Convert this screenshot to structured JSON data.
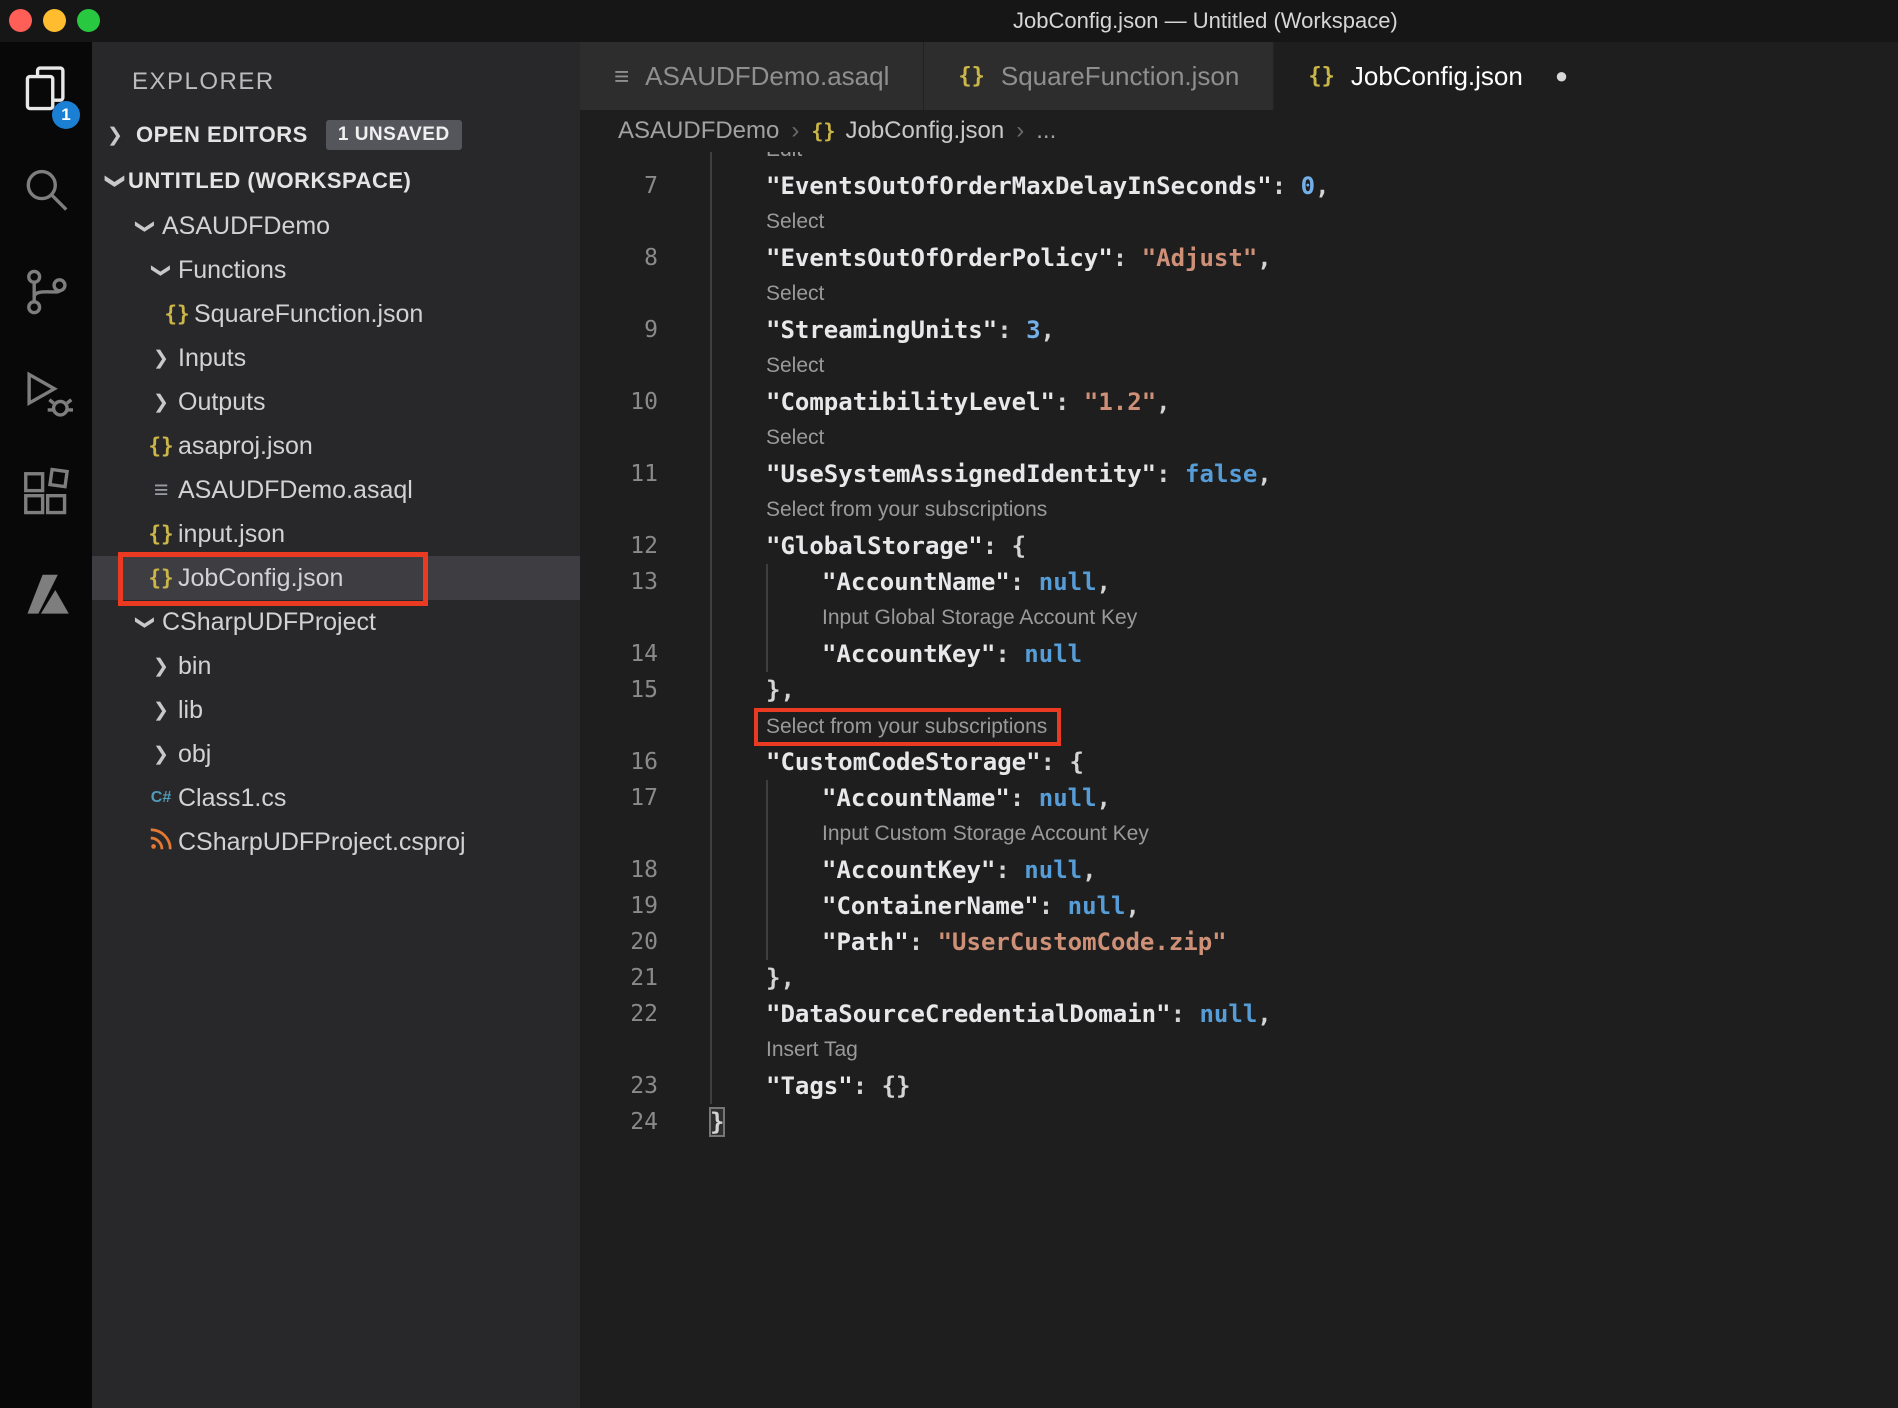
{
  "window": {
    "title": "JobConfig.json — Untitled (Workspace)"
  },
  "colors": {
    "annotation_red": "#ea3a21",
    "badge_blue": "#1b80d4",
    "json_icon_yellow": "#cbb648",
    "string_orange": "#ce9178",
    "keyword_blue": "#569cd6"
  },
  "activity_bar": {
    "badge": "1",
    "items": [
      {
        "name": "explorer",
        "active": true
      },
      {
        "name": "search",
        "active": false
      },
      {
        "name": "source-control",
        "active": false
      },
      {
        "name": "run-debug",
        "active": false
      },
      {
        "name": "extensions",
        "active": false
      },
      {
        "name": "azure",
        "active": false
      }
    ]
  },
  "explorer": {
    "title": "EXPLORER",
    "open_editors": {
      "label": "OPEN EDITORS",
      "badge": "1 UNSAVED"
    },
    "workspace_label": "UNTITLED (WORKSPACE)",
    "tree": [
      {
        "label": "ASAUDFDemo",
        "type": "folder",
        "state": "expanded",
        "depth": 1
      },
      {
        "label": "Functions",
        "type": "folder",
        "state": "expanded",
        "depth": 2
      },
      {
        "label": "SquareFunction.json",
        "type": "json",
        "depth": 3
      },
      {
        "label": "Inputs",
        "type": "folder",
        "state": "collapsed",
        "depth": 2
      },
      {
        "label": "Outputs",
        "type": "folder",
        "state": "collapsed",
        "depth": 2
      },
      {
        "label": "asaproj.json",
        "type": "json",
        "depth": 2
      },
      {
        "label": "ASAUDFDemo.asaql",
        "type": "asaql",
        "depth": 2
      },
      {
        "label": "input.json",
        "type": "json",
        "depth": 2
      },
      {
        "label": "JobConfig.json",
        "type": "json",
        "depth": 2,
        "selected": true,
        "red_box": true
      },
      {
        "label": "CSharpUDFProject",
        "type": "folder",
        "state": "expanded",
        "depth": 1
      },
      {
        "label": "bin",
        "type": "folder",
        "state": "collapsed",
        "depth": 2
      },
      {
        "label": "lib",
        "type": "folder",
        "state": "collapsed",
        "depth": 2
      },
      {
        "label": "obj",
        "type": "folder",
        "state": "collapsed",
        "depth": 2
      },
      {
        "label": "Class1.cs",
        "type": "cs",
        "depth": 2
      },
      {
        "label": "CSharpUDFProject.csproj",
        "type": "csproj",
        "depth": 2
      }
    ]
  },
  "tabs": [
    {
      "label": "ASAUDFDemo.asaql",
      "icon": "asaql",
      "active": false,
      "dirty": false
    },
    {
      "label": "SquareFunction.json",
      "icon": "json",
      "active": false,
      "dirty": false
    },
    {
      "label": "JobConfig.json",
      "icon": "json",
      "active": true,
      "dirty": true
    }
  ],
  "breadcrumb": {
    "items": [
      {
        "label": "ASAUDFDemo",
        "icon": null
      },
      {
        "label": "JobConfig.json",
        "icon": "json"
      },
      {
        "label": "...",
        "icon": null
      }
    ]
  },
  "editor": {
    "rows": [
      {
        "kind": "lens",
        "text": "Edit",
        "indent": 1,
        "guides": 1,
        "clipped": true
      },
      {
        "kind": "code",
        "num": "7",
        "indent": 1,
        "guides": 1,
        "tokens": [
          [
            "key",
            "\"EventsOutOfOrderMaxDelayInSeconds\""
          ],
          [
            "punct",
            ": "
          ],
          [
            "num",
            "0"
          ],
          [
            "punct",
            ","
          ]
        ]
      },
      {
        "kind": "lens",
        "text": "Select",
        "indent": 1,
        "guides": 1
      },
      {
        "kind": "code",
        "num": "8",
        "indent": 1,
        "guides": 1,
        "tokens": [
          [
            "key",
            "\"EventsOutOfOrderPolicy\""
          ],
          [
            "punct",
            ": "
          ],
          [
            "str",
            "\"Adjust\""
          ],
          [
            "punct",
            ","
          ]
        ]
      },
      {
        "kind": "lens",
        "text": "Select",
        "indent": 1,
        "guides": 1
      },
      {
        "kind": "code",
        "num": "9",
        "indent": 1,
        "guides": 1,
        "tokens": [
          [
            "key",
            "\"StreamingUnits\""
          ],
          [
            "punct",
            ": "
          ],
          [
            "num",
            "3"
          ],
          [
            "punct",
            ","
          ]
        ]
      },
      {
        "kind": "lens",
        "text": "Select",
        "indent": 1,
        "guides": 1
      },
      {
        "kind": "code",
        "num": "10",
        "indent": 1,
        "guides": 1,
        "tokens": [
          [
            "key",
            "\"CompatibilityLevel\""
          ],
          [
            "punct",
            ": "
          ],
          [
            "str",
            "\"1.2\""
          ],
          [
            "punct",
            ","
          ]
        ]
      },
      {
        "kind": "lens",
        "text": "Select",
        "indent": 1,
        "guides": 1
      },
      {
        "kind": "code",
        "num": "11",
        "indent": 1,
        "guides": 1,
        "tokens": [
          [
            "key",
            "\"UseSystemAssignedIdentity\""
          ],
          [
            "punct",
            ": "
          ],
          [
            "kw",
            "false"
          ],
          [
            "punct",
            ","
          ]
        ]
      },
      {
        "kind": "lens",
        "text": "Select from your subscriptions",
        "indent": 1,
        "guides": 1
      },
      {
        "kind": "code",
        "num": "12",
        "indent": 1,
        "guides": 1,
        "tokens": [
          [
            "key",
            "\"GlobalStorage\""
          ],
          [
            "punct",
            ": "
          ],
          [
            "punct",
            "{"
          ]
        ]
      },
      {
        "kind": "code",
        "num": "13",
        "indent": 2,
        "guides": 2,
        "tokens": [
          [
            "key",
            "\"AccountName\""
          ],
          [
            "punct",
            ": "
          ],
          [
            "kw",
            "null"
          ],
          [
            "punct",
            ","
          ]
        ]
      },
      {
        "kind": "lens",
        "text": "Input Global Storage Account Key",
        "indent": 2,
        "guides": 2
      },
      {
        "kind": "code",
        "num": "14",
        "indent": 2,
        "guides": 2,
        "tokens": [
          [
            "key",
            "\"AccountKey\""
          ],
          [
            "punct",
            ": "
          ],
          [
            "kw",
            "null"
          ]
        ]
      },
      {
        "kind": "code",
        "num": "15",
        "indent": 1,
        "guides": 1,
        "tokens": [
          [
            "punct",
            "},"
          ]
        ]
      },
      {
        "kind": "lens",
        "text": "Select from your subscriptions",
        "indent": 1,
        "guides": 1,
        "boxed": true
      },
      {
        "kind": "code",
        "num": "16",
        "indent": 1,
        "guides": 1,
        "tokens": [
          [
            "key",
            "\"CustomCodeStorage\""
          ],
          [
            "punct",
            ": "
          ],
          [
            "punct",
            "{"
          ]
        ]
      },
      {
        "kind": "code",
        "num": "17",
        "indent": 2,
        "guides": 2,
        "tokens": [
          [
            "key",
            "\"AccountName\""
          ],
          [
            "punct",
            ": "
          ],
          [
            "kw",
            "null"
          ],
          [
            "punct",
            ","
          ]
        ]
      },
      {
        "kind": "lens",
        "text": "Input Custom Storage Account Key",
        "indent": 2,
        "guides": 2
      },
      {
        "kind": "code",
        "num": "18",
        "indent": 2,
        "guides": 2,
        "tokens": [
          [
            "key",
            "\"AccountKey\""
          ],
          [
            "punct",
            ": "
          ],
          [
            "kw",
            "null"
          ],
          [
            "punct",
            ","
          ]
        ]
      },
      {
        "kind": "code",
        "num": "19",
        "indent": 2,
        "guides": 2,
        "tokens": [
          [
            "key",
            "\"ContainerName\""
          ],
          [
            "punct",
            ": "
          ],
          [
            "kw",
            "null"
          ],
          [
            "punct",
            ","
          ]
        ]
      },
      {
        "kind": "code",
        "num": "20",
        "indent": 2,
        "guides": 2,
        "tokens": [
          [
            "key",
            "\"Path\""
          ],
          [
            "punct",
            ": "
          ],
          [
            "str",
            "\"UserCustomCode.zip\""
          ]
        ]
      },
      {
        "kind": "code",
        "num": "21",
        "indent": 1,
        "guides": 1,
        "tokens": [
          [
            "punct",
            "},"
          ]
        ]
      },
      {
        "kind": "code",
        "num": "22",
        "indent": 1,
        "guides": 1,
        "tokens": [
          [
            "key",
            "\"DataSourceCredentialDomain\""
          ],
          [
            "punct",
            ": "
          ],
          [
            "kw",
            "null"
          ],
          [
            "punct",
            ","
          ]
        ]
      },
      {
        "kind": "lens",
        "text": "Insert Tag",
        "indent": 1,
        "guides": 1
      },
      {
        "kind": "code",
        "num": "23",
        "indent": 1,
        "guides": 1,
        "tokens": [
          [
            "key",
            "\"Tags\""
          ],
          [
            "punct",
            ": "
          ],
          [
            "punct",
            "{}"
          ]
        ]
      },
      {
        "kind": "code",
        "num": "24",
        "indent": 0,
        "guides": 0,
        "tokens": [
          [
            "punct-match",
            "}"
          ]
        ]
      }
    ]
  }
}
